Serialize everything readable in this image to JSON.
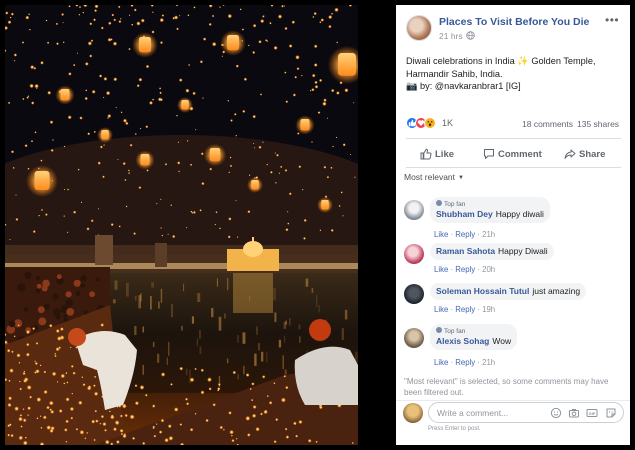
{
  "post": {
    "page_name": "Places To Visit Before You Die",
    "time": "21 hrs",
    "caption_line1": "Diwali celebrations in India ✨ Golden Temple,",
    "caption_line2": "Harmandir Sahib, India.",
    "caption_line3": "📷 by: @navkaranbrar1 [IG]",
    "more_icon": "•••"
  },
  "stats": {
    "reactions_count": "1K",
    "comments_count": "18 comments",
    "shares_count": "135 shares",
    "reaction_icons": [
      "like-icon",
      "love-icon",
      "wow-icon"
    ],
    "colors": {
      "like": "#1877f2",
      "love": "#f33e58",
      "wow": "#f7b125"
    }
  },
  "actions": {
    "like_label": "Like",
    "comment_label": "Comment",
    "share_label": "Share"
  },
  "sort": {
    "label": "Most relevant"
  },
  "comments": [
    {
      "top_fan": true,
      "top_fan_label": "Top fan",
      "name": "Shubham Dey",
      "text": "Happy diwali",
      "like": "Like",
      "reply": "Reply",
      "time": "21h"
    },
    {
      "top_fan": false,
      "name": "Raman Sahota",
      "text": "Happy Diwali",
      "like": "Like",
      "reply": "Reply",
      "time": "20h"
    },
    {
      "top_fan": false,
      "name": "Soleman Hossain Tutul",
      "text": "just amazing",
      "like": "Like",
      "reply": "Reply",
      "time": "19h"
    },
    {
      "top_fan": true,
      "top_fan_label": "Top fan",
      "name": "Alexis Sohag",
      "text": "Wow",
      "like": "Like",
      "reply": "Reply",
      "time": "21h"
    }
  ],
  "filter_notice": "\"Most relevant\" is selected, so some comments may have been filtered out.",
  "composer": {
    "placeholder": "Write a comment...",
    "hint": "Press Enter to post.",
    "icons": [
      "emoji-icon",
      "camera-icon",
      "gif-icon",
      "sticker-icon"
    ]
  },
  "theme": {
    "link": "#385898",
    "muted": "#90949c",
    "divider": "#dadde1",
    "bubble": "#f2f3f5"
  }
}
